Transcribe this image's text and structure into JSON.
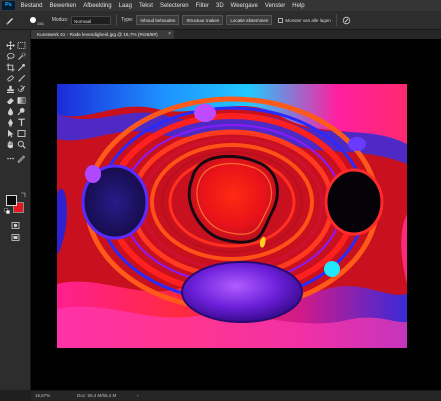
{
  "app": {
    "logo_text": "Ps"
  },
  "menubar": {
    "items": [
      "Bestand",
      "Bewerken",
      "Afbeelding",
      "Laag",
      "Tekst",
      "Selecteren",
      "Filter",
      "3D",
      "Weergave",
      "Venster",
      "Help"
    ]
  },
  "options": {
    "brush_size": "150",
    "mode_label": "Modus:",
    "mode_value": "Normaal",
    "type_label": "Type:",
    "btn_content_aware": "Inhoud behouden",
    "btn_create_texture": "Structuur maken",
    "btn_proximity_match": "Locatie afstemmen",
    "sample_all_layers_label": "Monster van alle lagen",
    "sample_all_layers_checked": false
  },
  "document": {
    "tab_title": "Kunstwerk 41 - Rode levendigheid.jpg @ 16,7% (RGB/8#)",
    "close_symbol": "×"
  },
  "toolbar": {
    "foreground_color": "#0a0a0a",
    "background_color": "#e5161e",
    "tools": [
      "move-tool",
      "marquee-tool",
      "lasso-tool",
      "quick-select-tool",
      "crop-tool",
      "eyedropper-tool",
      "spot-healing-tool",
      "brush-tool",
      "clone-stamp-tool",
      "history-brush-tool",
      "eraser-tool",
      "gradient-tool",
      "blur-tool",
      "dodge-tool",
      "pen-tool",
      "type-tool",
      "path-select-tool",
      "rectangle-tool",
      "hand-tool",
      "zoom-tool"
    ]
  },
  "status": {
    "zoom": "16,67%",
    "doc_info": "Doc: 55,4 M/55,4 M",
    "arrow": "›"
  }
}
